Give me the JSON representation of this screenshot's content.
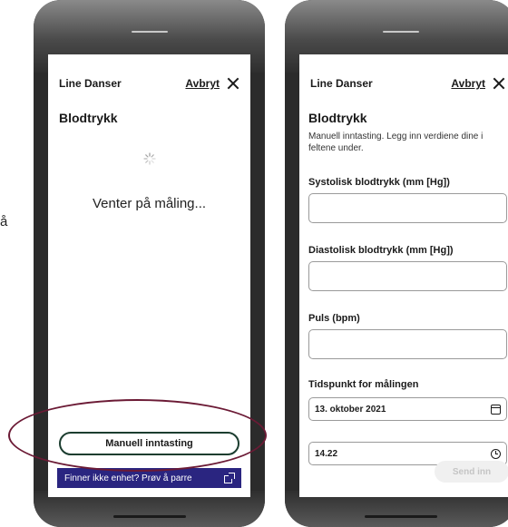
{
  "stray_text": "å",
  "left_screen": {
    "user_name": "Line Danser",
    "cancel_label": "Avbryt",
    "title": "Blodtrykk",
    "waiting_text": "Venter på måling...",
    "manual_button": "Manuell inntasting",
    "pair_bar": "Finner ikke enhet? Prøv å parre"
  },
  "right_screen": {
    "user_name": "Line Danser",
    "cancel_label": "Avbryt",
    "title": "Blodtrykk",
    "subtitle": "Manuell inntasting. Legg inn verdiene dine i feltene under.",
    "fields": [
      {
        "label": "Systolisk blodtrykk (mm [Hg])",
        "value": ""
      },
      {
        "label": "Diastolisk blodtrykk (mm [Hg])",
        "value": ""
      },
      {
        "label": "Puls (bpm)",
        "value": ""
      }
    ],
    "time_label": "Tidspunkt for målingen",
    "date_value": "13. oktober 2021",
    "time_value": "14.22",
    "send_button": "Send inn"
  },
  "colors": {
    "pair_bar_bg": "#2a2580",
    "annotation": "#6b1a35",
    "button_border": "#1b3d2f"
  }
}
